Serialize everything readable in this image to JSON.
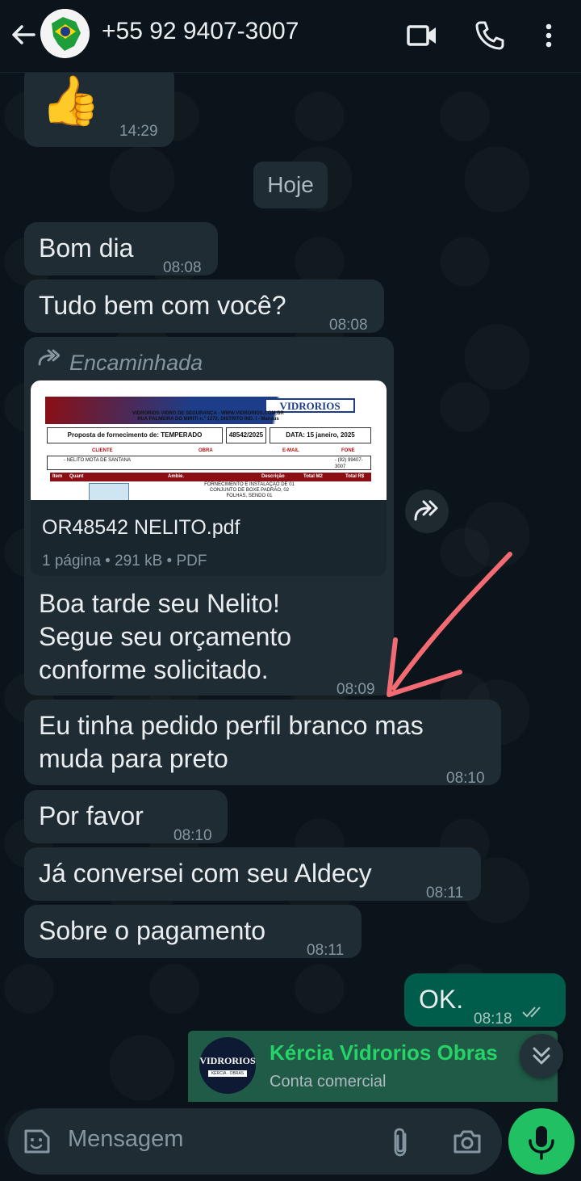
{
  "header": {
    "title": "+55 92 9407-3007",
    "icons": [
      "back-arrow-icon",
      "video-call-icon",
      "phone-icon",
      "more-vert-icon"
    ]
  },
  "chat": {
    "prev_message_time": "14:29",
    "date_chip": "Hoje",
    "messages": [
      {
        "text": "Bom dia",
        "time": "08:08"
      },
      {
        "text": "Tudo bem com você?",
        "time": "08:08"
      },
      {
        "forwarded_label": "Encaminhada",
        "document": {
          "filename": "OR48542 NELITO.pdf",
          "meta": "1 página • 291 kB • PDF",
          "preview": {
            "logo": "VIDRORIOS",
            "company_line1": "VIDRORIOS VIDRO DE SEGURANÇA - WWW.VIDRORIOS.COM.BR",
            "company_line2": "RUA PALMEIRA DO MIRITI n.º 1272, DISTRITO IND. I - Manaus",
            "proposal": "Proposta de fornecimento de: TEMPERADO",
            "number": "48542/2025",
            "date": "DATA: 15 janeiro, 2025",
            "col_cliente": "CLIENTE",
            "col_obra": "OBRA",
            "col_email": "E-MAIL",
            "col_fone": "FONE",
            "cliente": "- NELITO MOTA DE SANTANA",
            "fone": "- (92) 99407-3007",
            "th_item": "Item",
            "th_quant": "Quant",
            "th_ambie": "Ambie.",
            "th_desc": "Descrição",
            "th_total_m2": "Total M2",
            "th_total_rs": "Total R$",
            "desc_text": "FORNECIMENTO E INSTALAÇÃO DE 01 CONJUNTO DE BOXE PADRÃO, 02 FOLHAS, SENDO 01"
          }
        },
        "lines": [
          "Boa tarde seu Nelito!",
          "Segue seu orçamento",
          "conforme solicitado."
        ],
        "time": "08:09"
      },
      {
        "lines": [
          "Eu tinha pedido perfil branco mas",
          "muda para preto"
        ],
        "time": "08:10"
      },
      {
        "text": "Por favor",
        "time": "08:10"
      },
      {
        "text": "Já conversei com seu Aldecy",
        "time": "08:11"
      },
      {
        "text": "Sobre o pagamento",
        "time": "08:11"
      },
      {
        "text": "OK.",
        "time": "08:18",
        "outgoing": true
      }
    ]
  },
  "business": {
    "name": "Kércia Vidrorios Obras",
    "subtitle": "Conta comercial",
    "logo_text": "VIDRORIOS",
    "logo_sub": "KÉRCIA · OBRAS"
  },
  "input": {
    "placeholder": "Mensagem"
  },
  "colors": {
    "bg": "#0b141a",
    "incoming_bubble": "#202c33",
    "outgoing_bubble": "#005c4b",
    "accent_green": "#25d366",
    "annotation_arrow": "#f26b73"
  }
}
